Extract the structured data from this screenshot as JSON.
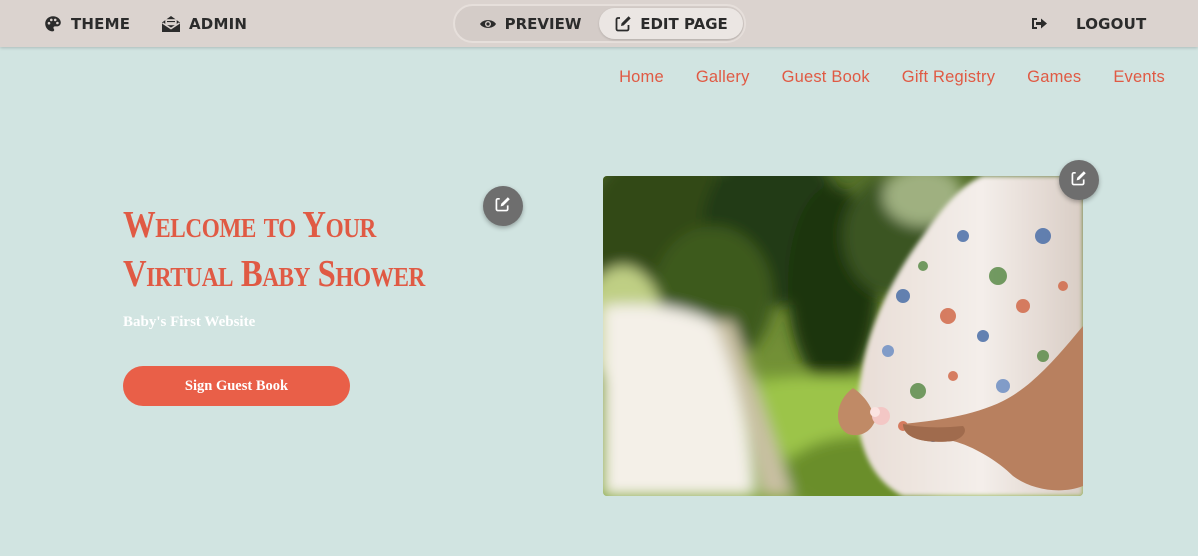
{
  "admin_bar": {
    "theme_label": "THEME",
    "admin_label": "ADMIN",
    "preview_label": "PREVIEW",
    "edit_label": "EDIT PAGE",
    "logout_label": "LOGOUT",
    "active_mode": "edit"
  },
  "nav": {
    "items": [
      {
        "label": "Home"
      },
      {
        "label": "Gallery"
      },
      {
        "label": "Guest Book"
      },
      {
        "label": "Gift Registry"
      },
      {
        "label": "Games"
      },
      {
        "label": "Events"
      }
    ]
  },
  "hero": {
    "title": "Welcome to Your Virtual Baby Shower",
    "subtitle": "Baby's First Website",
    "cta_label": "Sign Guest Book"
  },
  "colors": {
    "page_bg": "#d1e4e1",
    "accent": "#e05a44",
    "button": "#e95f48",
    "admin_bar": "#dbd3cf"
  },
  "icons": {
    "theme": "palette-icon",
    "admin": "envelope-open-icon",
    "preview": "eye-icon",
    "edit": "edit-icon",
    "logout": "sign-out-icon",
    "edit_fab": "edit-icon"
  }
}
